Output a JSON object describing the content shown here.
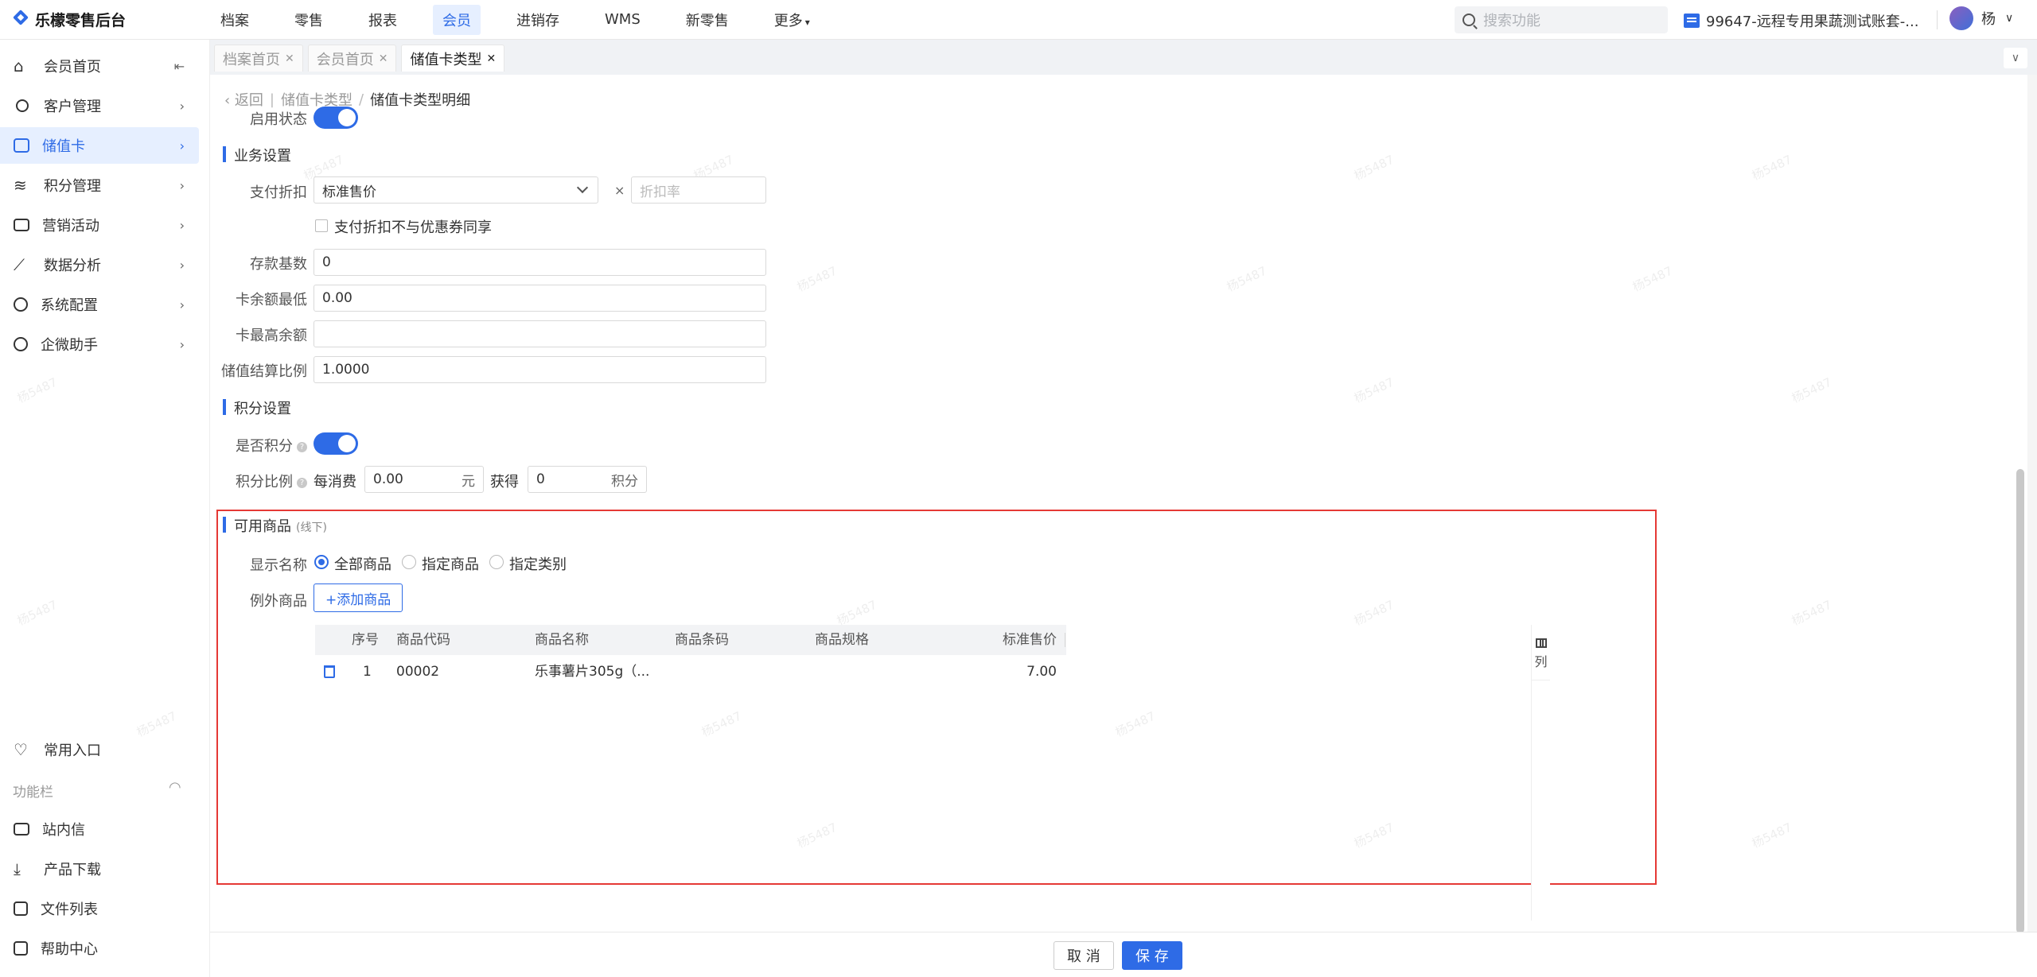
{
  "app": {
    "logo_text": "乐檬零售后台"
  },
  "topnav": {
    "items": [
      "档案",
      "零售",
      "报表",
      "会员",
      "进销存",
      "WMS",
      "新零售",
      "更多"
    ],
    "search_placeholder": "搜索功能",
    "store_name": "99647-远程专用果蔬测试账套-...",
    "user_name": "杨"
  },
  "sidebar": {
    "items": [
      "会员首页",
      "客户管理",
      "储值卡",
      "积分管理",
      "营销活动",
      "数据分析",
      "系统配置",
      "企微助手"
    ],
    "favorites": "常用入口",
    "function_bar": "功能栏",
    "bottom_items": [
      "站内信",
      "产品下载",
      "文件列表",
      "帮助中心"
    ]
  },
  "tabs": [
    "档案首页",
    "会员首页",
    "储值卡类型"
  ],
  "breadcrumb": {
    "back": "返回",
    "parent": "储值卡类型",
    "current": "储值卡类型明细"
  },
  "form": {
    "enable_label": "启用状态",
    "business_section": "业务设置",
    "pay_discount_label": "支付折扣",
    "pay_discount_value": "标准售价",
    "multiply": "×",
    "discount_rate_placeholder": "折扣率",
    "no_coupon_label": "支付折扣不与优惠券同享",
    "deposit_base_label": "存款基数",
    "deposit_base_value": "0",
    "min_balance_label": "卡余额最低",
    "min_balance_value": "0.00",
    "max_balance_label": "卡最高余额",
    "max_balance_value": "",
    "settle_ratio_label": "储值结算比例",
    "settle_ratio_value": "1.0000",
    "points_section": "积分设置",
    "points_enabled_label": "是否积分",
    "points_ratio_label": "积分比例",
    "per_spend": "每消费",
    "spend_value": "0.00",
    "yuan": "元",
    "get": "获得",
    "points_value": "0",
    "points_unit": "积分"
  },
  "available_goods": {
    "title": "可用商品",
    "subtitle": "(线下)",
    "display_label": "显示名称",
    "radios": [
      "全部商品",
      "指定商品",
      "指定类别"
    ],
    "selected_radio": "全部商品",
    "exception_label": "例外商品",
    "add_button": "+添加商品",
    "columns": [
      "序号",
      "商品代码",
      "商品名称",
      "商品条码",
      "商品规格",
      "标准售价"
    ],
    "rows": [
      {
        "index": "1",
        "code": "00002",
        "name": "乐事薯片305g（...",
        "barcode": "",
        "spec": "",
        "price": "7.00"
      }
    ],
    "column_setting": "列"
  },
  "footer": {
    "cancel": "取 消",
    "save": "保 存"
  },
  "watermark": "杨5487",
  "colors": {
    "primary": "#2e6be6",
    "highlight_border": "#e53935"
  }
}
